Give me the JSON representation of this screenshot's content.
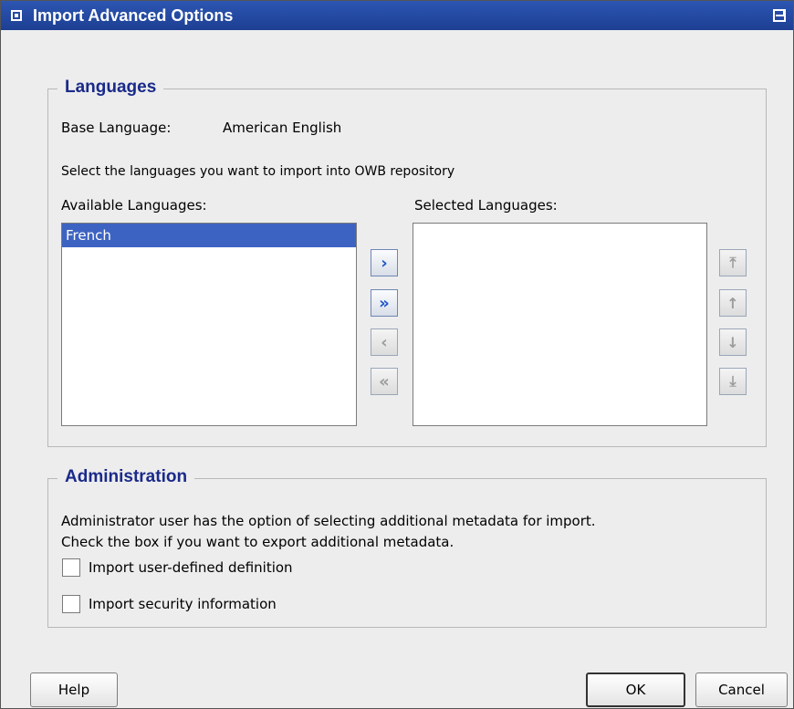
{
  "window": {
    "title": "Import Advanced Options"
  },
  "languages": {
    "legend": "Languages",
    "base_language_label": "Base Language:",
    "base_language_value": "American English",
    "instructions": "Select the languages you want to import  into OWB repository",
    "available_label": "Available Languages:",
    "selected_label": "Selected Languages:",
    "available_items": [
      "French"
    ],
    "selected_items": []
  },
  "shuttle_buttons": [
    {
      "icon": "chevron-right-icon",
      "glyph": "›",
      "enabled": true
    },
    {
      "icon": "double-chevron-right-icon",
      "glyph": "»",
      "enabled": true
    },
    {
      "icon": "chevron-left-icon",
      "glyph": "‹",
      "enabled": false
    },
    {
      "icon": "double-chevron-left-icon",
      "glyph": "«",
      "enabled": false
    }
  ],
  "order_buttons": [
    {
      "icon": "move-top-icon",
      "glyph": "⤒"
    },
    {
      "icon": "move-up-icon",
      "glyph": "↑"
    },
    {
      "icon": "move-down-icon",
      "glyph": "↓"
    },
    {
      "icon": "move-bottom-icon",
      "glyph": "⤓"
    }
  ],
  "administration": {
    "legend": "Administration",
    "desc_line1": "Administrator user has the option of selecting additional metadata for import.",
    "desc_line2": "Check the box if you want to export additional metadata.",
    "checkbox_user_defined": {
      "label": "Import user-defined definition",
      "checked": false
    },
    "checkbox_security": {
      "label": "Import security information",
      "checked": false
    }
  },
  "footer": {
    "help": "Help",
    "ok": "OK",
    "cancel": "Cancel"
  }
}
